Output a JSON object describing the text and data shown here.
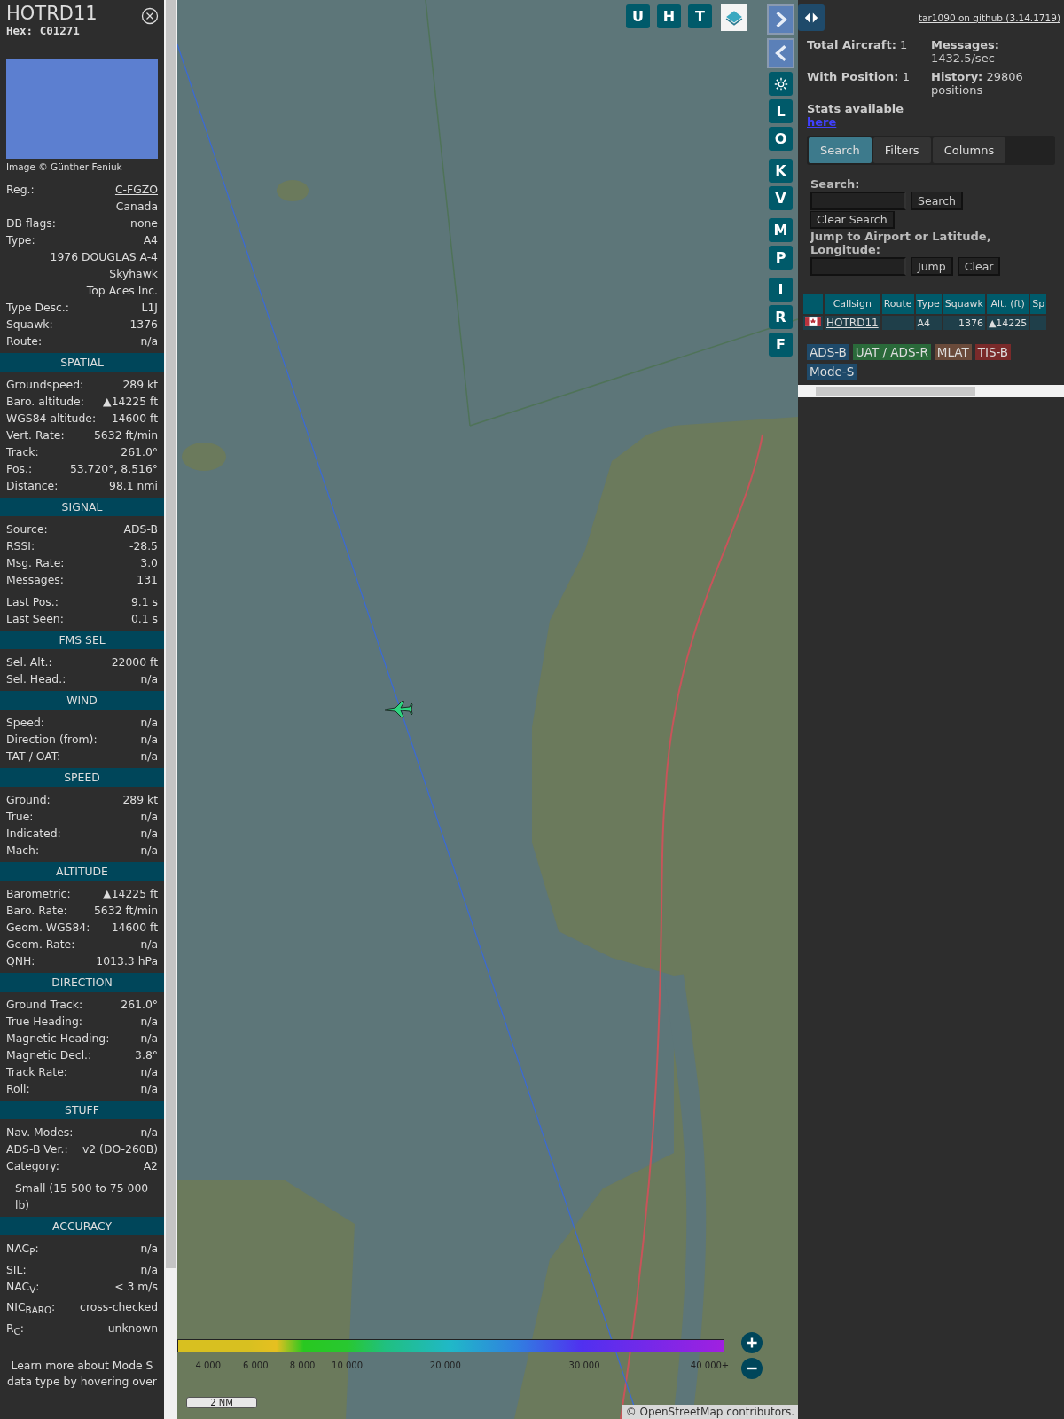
{
  "detail": {
    "callsign": "HOTRD11",
    "hex": "Hex: C01271",
    "photo_credit": "Image © Günther Feniuk",
    "sections": [
      {
        "rows": [
          {
            "label": "Reg.:",
            "value": "C-FGZO",
            "kind": "link"
          },
          {
            "label": "",
            "value": "Canada",
            "kind": "text"
          },
          {
            "label": "DB flags:",
            "value": "none",
            "kind": "text"
          },
          {
            "label": "Type:",
            "value": "A4",
            "kind": "text"
          },
          {
            "label": "",
            "value": "1976 DOUGLAS A-4 Skyhawk",
            "kind": "text"
          },
          {
            "label": "",
            "value": "Top Aces Inc.",
            "kind": "text"
          },
          {
            "label": "Type Desc.:",
            "value": "L1J",
            "kind": "text"
          },
          {
            "label": "Squawk:",
            "value": "1376",
            "kind": "text"
          },
          {
            "label": "Route:",
            "value": "n/a",
            "kind": "text"
          }
        ]
      },
      {
        "title": "SPATIAL",
        "rows": [
          {
            "label": "Groundspeed:",
            "value": "289 kt",
            "kind": "text"
          },
          {
            "label": "Baro. altitude:",
            "value": "▲14225 ft",
            "kind": "text"
          },
          {
            "label": "WGS84 altitude:",
            "value": "14600 ft",
            "kind": "text"
          },
          {
            "label": "Vert. Rate:",
            "value": "5632 ft/min",
            "kind": "text"
          },
          {
            "label": "Track:",
            "value": "261.0°",
            "kind": "text"
          },
          {
            "label": "Pos.:",
            "value": "53.720°, 8.516°",
            "kind": "text"
          },
          {
            "label": "Distance:",
            "value": "98.1 nmi",
            "kind": "text"
          }
        ]
      },
      {
        "title": "SIGNAL",
        "rows": [
          {
            "label": "Source:",
            "value": "ADS-B",
            "kind": "text"
          },
          {
            "label": "RSSI:",
            "value": "-28.5",
            "kind": "text"
          },
          {
            "label": "Msg. Rate:",
            "value": "3.0",
            "kind": "text"
          },
          {
            "label": "Messages:",
            "value": "131",
            "kind": "text"
          },
          {
            "label": "Last Pos.:",
            "value": "9.1 s",
            "kind": "gap"
          },
          {
            "label": "Last Seen:",
            "value": "0.1 s",
            "kind": "text"
          }
        ]
      },
      {
        "title": "FMS SEL",
        "rows": [
          {
            "label": "Sel. Alt.:",
            "value": "22000 ft",
            "kind": "text"
          },
          {
            "label": "Sel. Head.:",
            "value": "n/a",
            "kind": "text"
          }
        ]
      },
      {
        "title": "WIND",
        "rows": [
          {
            "label": "Speed:",
            "value": "n/a",
            "kind": "text"
          },
          {
            "label": "Direction (from):",
            "value": "n/a",
            "kind": "text"
          },
          {
            "label": "TAT / OAT:",
            "value": "n/a",
            "kind": "text"
          }
        ]
      },
      {
        "title": "SPEED",
        "rows": [
          {
            "label": "Ground:",
            "value": "289 kt",
            "kind": "text"
          },
          {
            "label": "True:",
            "value": "n/a",
            "kind": "text"
          },
          {
            "label": "Indicated:",
            "value": "n/a",
            "kind": "text"
          },
          {
            "label": "Mach:",
            "value": "n/a",
            "kind": "text"
          }
        ]
      },
      {
        "title": "ALTITUDE",
        "rows": [
          {
            "label": "Barometric:",
            "value": "▲14225 ft",
            "kind": "text"
          },
          {
            "label": "Baro. Rate:",
            "value": "5632 ft/min",
            "kind": "text"
          },
          {
            "label": "Geom. WGS84:",
            "value": "14600 ft",
            "kind": "text"
          },
          {
            "label": "Geom. Rate:",
            "value": "n/a",
            "kind": "text"
          },
          {
            "label": "QNH:",
            "value": "1013.3 hPa",
            "kind": "text"
          }
        ]
      },
      {
        "title": "DIRECTION",
        "rows": [
          {
            "label": "Ground Track:",
            "value": "261.0°",
            "kind": "text"
          },
          {
            "label": "True Heading:",
            "value": "n/a",
            "kind": "text"
          },
          {
            "label": "Magnetic Heading:",
            "value": "n/a",
            "kind": "text"
          },
          {
            "label": "Magnetic Decl.:",
            "value": "3.8°",
            "kind": "text"
          },
          {
            "label": "Track Rate:",
            "value": "n/a",
            "kind": "text"
          },
          {
            "label": "Roll:",
            "value": "n/a",
            "kind": "text"
          }
        ]
      },
      {
        "title": "STUFF",
        "rows": [
          {
            "label": "Nav. Modes:",
            "value": "n/a",
            "kind": "text"
          },
          {
            "label": "ADS-B Ver.:",
            "value": "v2 (DO-260B)",
            "kind": "text"
          },
          {
            "label": "Category:",
            "value": "A2",
            "kind": "text"
          },
          {
            "label": "Small (15 500 to 75 000 lb)",
            "value": "",
            "kind": "note"
          }
        ]
      },
      {
        "title": "ACCURACY",
        "rows": [
          {
            "label": "NAC$_{P}$:",
            "value": "n/a",
            "kind": "text"
          },
          {
            "label": "SIL:",
            "value": "n/a",
            "kind": "text"
          },
          {
            "label": "NAC$_{V}$:",
            "value": "< 3 m/s",
            "kind": "text"
          },
          {
            "label": "NIC$_{BARO}$:",
            "value": "cross-checked",
            "kind": "text"
          },
          {
            "label": "R$_{C}$:",
            "value": "unknown",
            "kind": "text"
          }
        ]
      }
    ],
    "footer": "Learn more about Mode S data type by hovering over"
  },
  "map": {
    "top_buttons": [
      "U",
      "H",
      "T"
    ],
    "side_buttons": [
      "L",
      "O",
      "K",
      "V",
      "M",
      "P",
      "I",
      "R",
      "F"
    ],
    "legend_ticks": [
      "4 000",
      "6 000",
      "8 000",
      "10 000",
      "20 000",
      "30 000",
      "40 000+"
    ],
    "scale": "2 NM",
    "attribution_prefix": "©",
    "attribution_link": "OpenStreetMap",
    "attribution_suffix": "contributors."
  },
  "panel": {
    "github_link": "tar1090 on github (3.14.1719)",
    "stats": [
      {
        "label": "Total Aircraft:",
        "value": "1"
      },
      {
        "label": "Messages:",
        "value": "1432.5/sec"
      },
      {
        "label": "With Position:",
        "value": "1"
      },
      {
        "label": "History:",
        "value": "29806 positions"
      }
    ],
    "stats_note": "Stats available",
    "stats_link": "here",
    "tabs": [
      {
        "label": "Search",
        "selected": true
      },
      {
        "label": "Filters",
        "selected": false
      },
      {
        "label": "Columns",
        "selected": false
      }
    ],
    "search_label": "Search:",
    "search_button": "Search",
    "clear_search_button": "Clear Search",
    "jump_label": "Jump to Airport or Latitude, Longitude:",
    "jump_button": "Jump",
    "clear_button": "Clear",
    "table": {
      "columns": [
        "Callsign",
        "Route",
        "Type",
        "Squawk",
        "Alt. (ft)",
        "Sp"
      ],
      "rows": [
        {
          "callsign": "HOTRD11",
          "route": "",
          "type": "A4",
          "squawk": "1376",
          "alt": "▲14225"
        }
      ]
    },
    "sources": [
      {
        "label": "ADS-B",
        "color": "#1f4a6a"
      },
      {
        "label": "UAT / ADS-R",
        "color": "#2a6a3a"
      },
      {
        "label": "MLAT",
        "color": "#6a4a3a"
      },
      {
        "label": "TIS-B",
        "color": "#7a2a2a"
      },
      {
        "label": "Mode-S",
        "color": "#1f4a6a"
      }
    ]
  }
}
